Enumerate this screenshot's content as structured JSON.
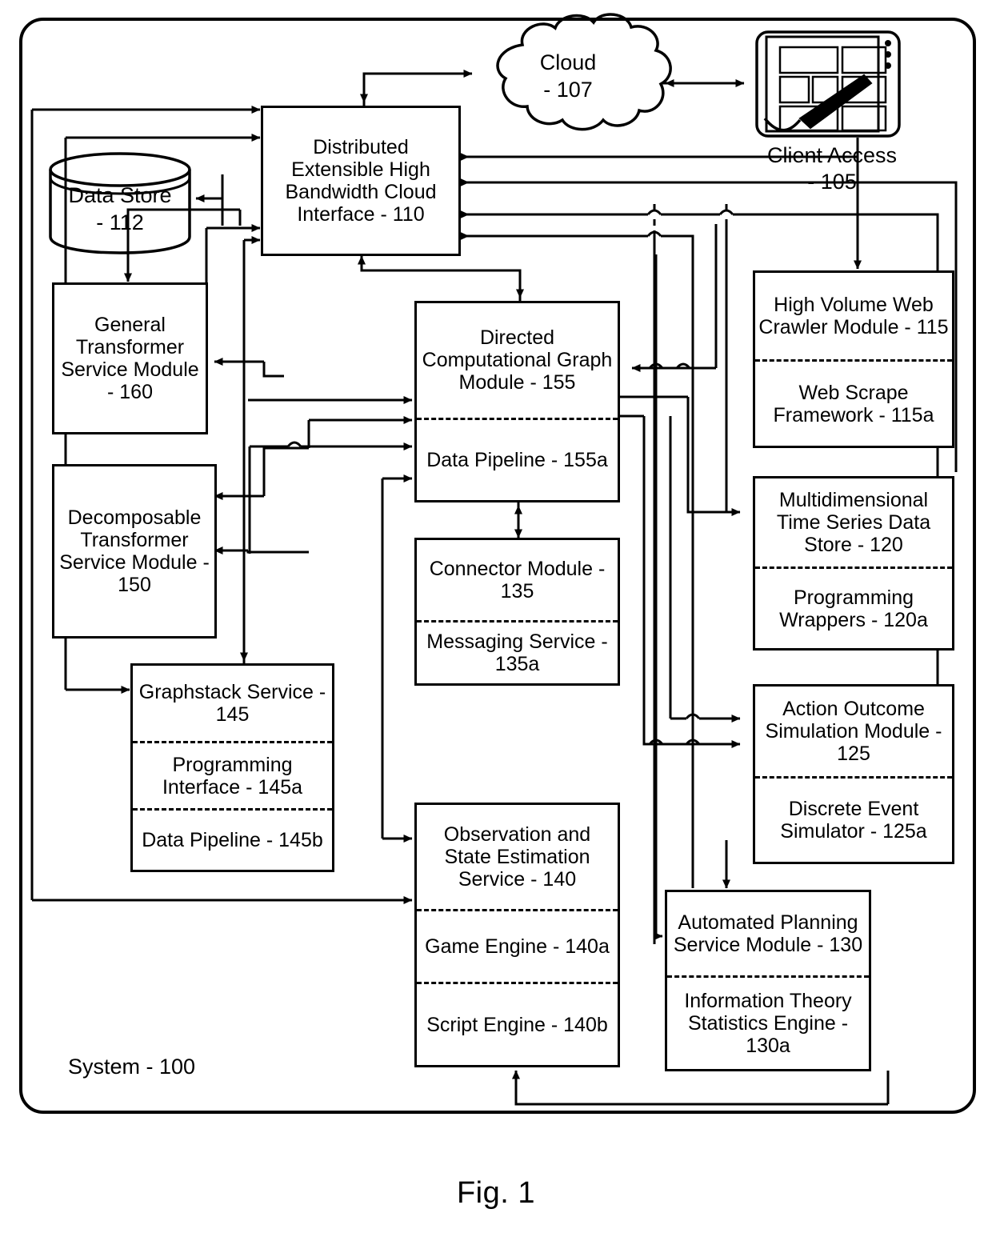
{
  "figure": {
    "caption": "Fig. 1",
    "system_label": "System - 100"
  },
  "nodes": {
    "cloud": {
      "name": "cloud-107",
      "line1": "Cloud",
      "line2": "- 107"
    },
    "client_access": {
      "name": "client-access-105",
      "line1": "Client Access",
      "line2": "- 105"
    },
    "data_store": {
      "name": "data-store-112",
      "line1": "Data Store",
      "line2": "- 112"
    },
    "cloud_interface": {
      "name": "distributed-extensible-high-bandwidth-cloud-interface-110",
      "text": "Distributed Extensible High Bandwidth Cloud Interface - 110"
    },
    "general_transformer": {
      "name": "general-transformer-service-module-160",
      "text": "General Transformer Service Module - 160"
    },
    "decomposable_transformer": {
      "name": "decomposable-transformer-service-module-150",
      "text": "Decomposable Transformer Service Module - 150"
    },
    "graphstack": {
      "name": "graphstack-service-145",
      "segments": [
        "Graphstack Service - 145",
        "Programming Interface - 145a",
        "Data Pipeline - 145b"
      ]
    },
    "directed_graph": {
      "name": "directed-computational-graph-module-155",
      "segments": [
        "Directed Computational Graph Module - 155",
        "Data Pipeline - 155a"
      ]
    },
    "connector": {
      "name": "connector-module-135",
      "segments": [
        "Connector Module - 135",
        "Messaging Service - 135a"
      ]
    },
    "observation": {
      "name": "observation-and-state-estimation-service-140",
      "segments": [
        "Observation and State Estimation Service - 140",
        "Game Engine - 140a",
        "Script Engine - 140b"
      ]
    },
    "web_crawler": {
      "name": "high-volume-web-crawler-module-115",
      "segments": [
        "High Volume Web Crawler Module - 115",
        "Web Scrape Framework - 115a"
      ]
    },
    "time_series_store": {
      "name": "multidimensional-time-series-data-store-120",
      "segments": [
        "Multidimensional Time Series Data Store - 120",
        "Programming Wrappers - 120a"
      ]
    },
    "action_outcome": {
      "name": "action-outcome-simulation-module-125",
      "segments": [
        "Action Outcome Simulation Module - 125",
        "Discrete Event Simulator - 125a"
      ]
    },
    "automated_planning": {
      "name": "automated-planning-service-module-130",
      "segments": [
        "Automated Planning Service Module - 130",
        "Information Theory Statistics Engine - 130a"
      ]
    }
  },
  "colors": {
    "stroke": "#000000",
    "background": "#ffffff"
  }
}
